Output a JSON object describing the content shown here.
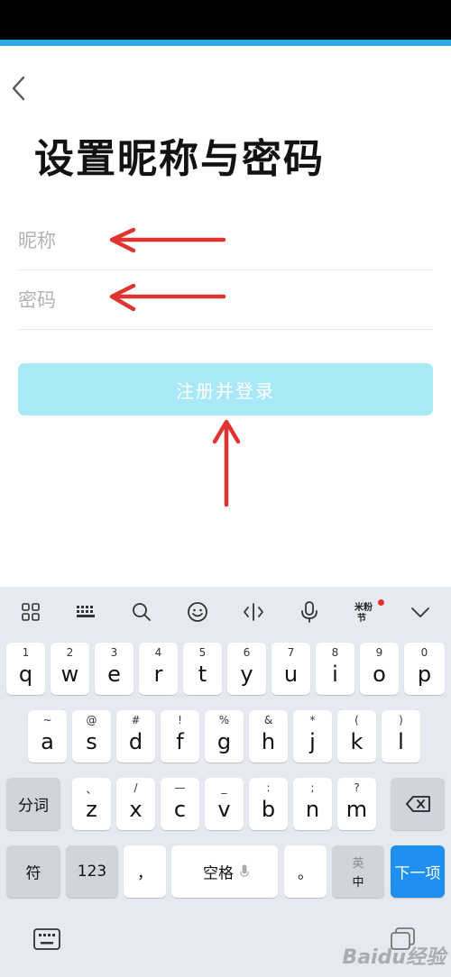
{
  "header": {
    "title": "设置昵称与密码"
  },
  "form": {
    "nickname_placeholder": "昵称",
    "password_placeholder": "密码",
    "register_label": "注册并登录"
  },
  "colors": {
    "accent": "#2fa8e6",
    "button_bg": "#a9e9f7",
    "arrow": "#e0342f",
    "next_key": "#1f8ff0"
  },
  "keyboard": {
    "toolbar": [
      "grid-icon",
      "keyboard-icon",
      "search-icon",
      "emoji-icon",
      "cursor-icon",
      "microphone-icon",
      "sticker-icon",
      "collapse-chevron-icon"
    ],
    "row1": [
      {
        "sub": "1",
        "main": "q"
      },
      {
        "sub": "2",
        "main": "w"
      },
      {
        "sub": "3",
        "main": "e"
      },
      {
        "sub": "4",
        "main": "r"
      },
      {
        "sub": "5",
        "main": "t"
      },
      {
        "sub": "6",
        "main": "y"
      },
      {
        "sub": "7",
        "main": "u"
      },
      {
        "sub": "8",
        "main": "i"
      },
      {
        "sub": "9",
        "main": "o"
      },
      {
        "sub": "0",
        "main": "p"
      }
    ],
    "row2": [
      {
        "sub": "~",
        "main": "a"
      },
      {
        "sub": "@",
        "main": "s"
      },
      {
        "sub": "#",
        "main": "d"
      },
      {
        "sub": "!",
        "main": "f"
      },
      {
        "sub": "%",
        "main": "g"
      },
      {
        "sub": "&",
        "main": "h"
      },
      {
        "sub": "*",
        "main": "j"
      },
      {
        "sub": "(",
        "main": "k"
      },
      {
        "sub": ")",
        "main": "l"
      }
    ],
    "row3": [
      {
        "sub": "、",
        "main": "z"
      },
      {
        "sub": "/",
        "main": "x"
      },
      {
        "sub": "—",
        "main": "c"
      },
      {
        "sub": "_",
        "main": "v"
      },
      {
        "sub": ":",
        "main": "b"
      },
      {
        "sub": ";",
        "main": "n"
      },
      {
        "sub": "?",
        "main": "m"
      }
    ],
    "fenci": "分词",
    "fu": "符",
    "num": "123",
    "comma": "，",
    "space": "空格",
    "period": "。",
    "lang_top": "英",
    "lang_bottom": "中",
    "next": "下一项",
    "watermark": "Baidu经验"
  }
}
